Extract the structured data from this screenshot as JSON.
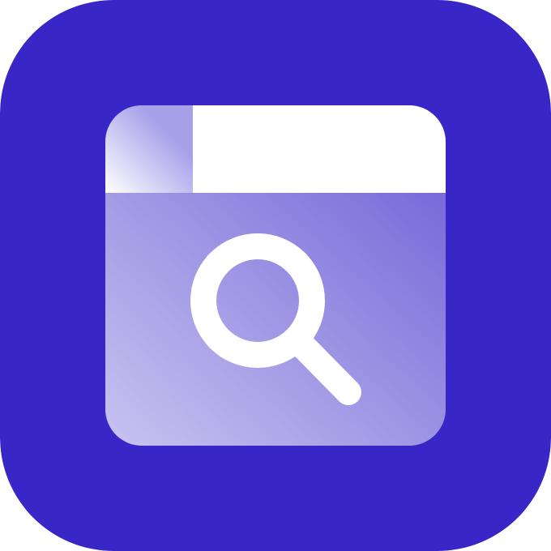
{
  "icon": {
    "name": "search-window-app-icon",
    "colors": {
      "background": "#3826C6",
      "panel_light": "#C6C1F0",
      "panel_dark": "#6D5FD6",
      "tab_white": "#FFFFFF",
      "tab_shade": "#A7A1EA",
      "magnifier": "#FFFFFF"
    },
    "glyph": "magnifying-glass-icon"
  }
}
